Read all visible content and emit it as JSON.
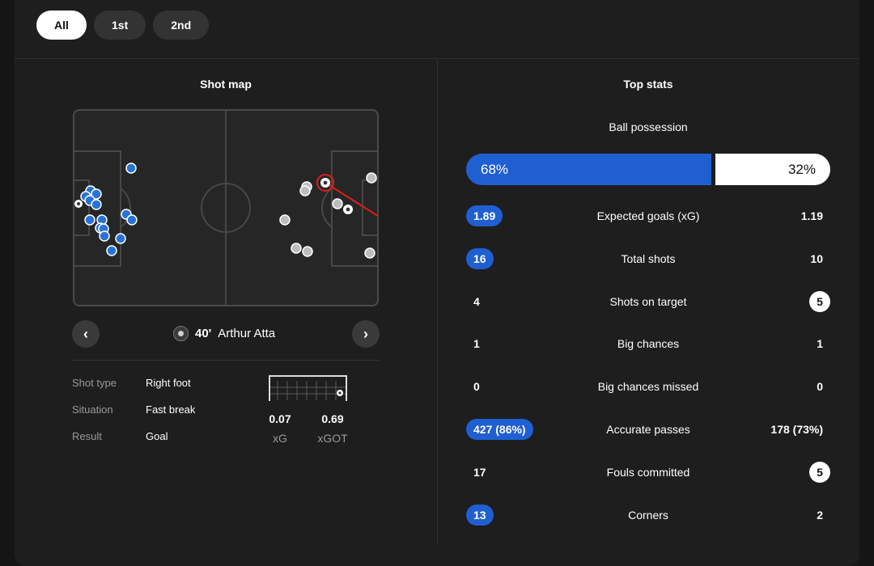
{
  "tabs": [
    "All",
    "1st",
    "2nd"
  ],
  "shot_map": {
    "title": "Shot map",
    "selected_shot": {
      "minute": "40'",
      "player": "Arthur Atta",
      "details": [
        {
          "label": "Shot type",
          "value": "Right foot"
        },
        {
          "label": "Situation",
          "value": "Fast break"
        },
        {
          "label": "Result",
          "value": "Goal"
        }
      ],
      "xg_value": "0.07",
      "xg_label": "xG",
      "xgot_value": "0.69",
      "xgot_label": "xGOT"
    },
    "colors": {
      "home": "#2a73d6",
      "away": "#bdbdbd",
      "highlight": "#e01e1e"
    }
  },
  "top_stats": {
    "title": "Top stats",
    "possession": {
      "label": "Ball possession",
      "home": "68%",
      "away": "32%",
      "home_fraction": 0.68
    },
    "rows": [
      {
        "label": "Expected goals (xG)",
        "home": "1.89",
        "away": "1.19",
        "highlight": "home"
      },
      {
        "label": "Total shots",
        "home": "16",
        "away": "10",
        "highlight": "home"
      },
      {
        "label": "Shots on target",
        "home": "4",
        "away": "5",
        "highlight": "away"
      },
      {
        "label": "Big chances",
        "home": "1",
        "away": "1",
        "highlight": "none"
      },
      {
        "label": "Big chances missed",
        "home": "0",
        "away": "0",
        "highlight": "none"
      },
      {
        "label": "Accurate passes",
        "home": "427 (86%)",
        "away": "178 (73%)",
        "highlight": "home"
      },
      {
        "label": "Fouls committed",
        "home": "17",
        "away": "5",
        "highlight": "away"
      },
      {
        "label": "Corners",
        "home": "13",
        "away": "2",
        "highlight": "home"
      }
    ]
  }
}
